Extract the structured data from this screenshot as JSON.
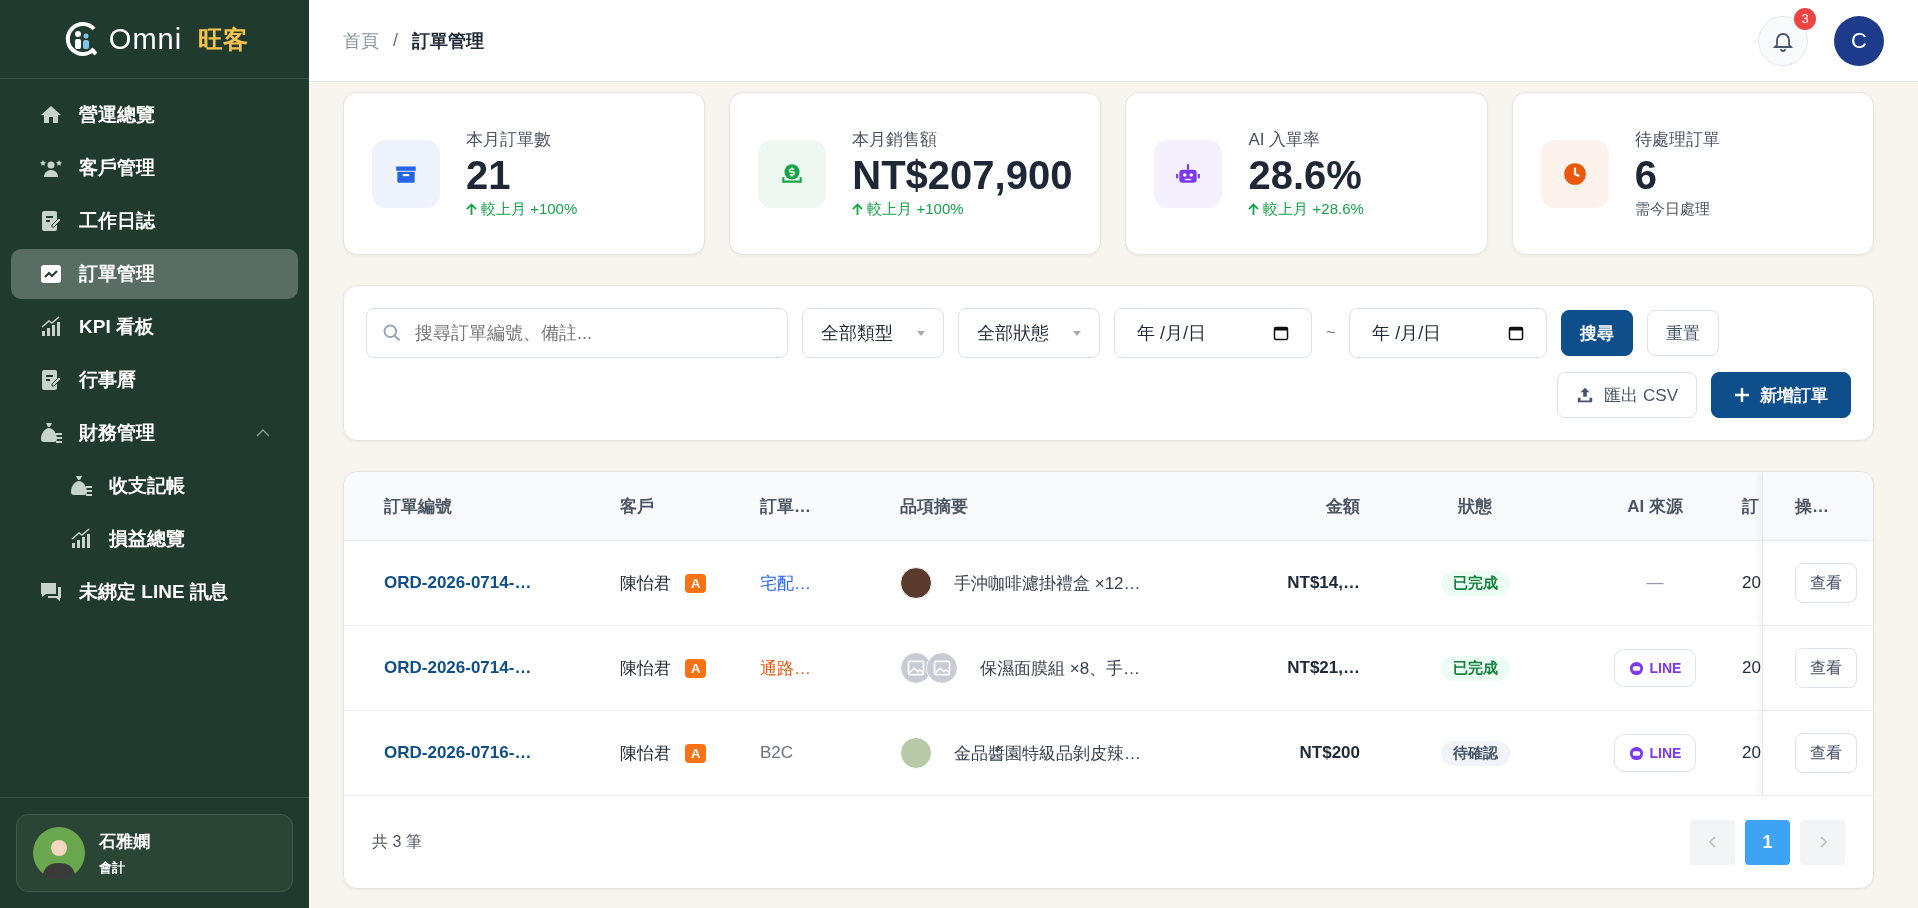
{
  "brand": {
    "name": "Omni",
    "suffix": "旺客"
  },
  "sidebar": {
    "items": [
      {
        "label": "營運總覽",
        "kind": "home",
        "selected": false
      },
      {
        "label": "客戶管理",
        "kind": "people",
        "selected": false
      },
      {
        "label": "工作日誌",
        "kind": "note",
        "selected": false
      },
      {
        "label": "訂單管理",
        "kind": "trend",
        "selected": true
      },
      {
        "label": "KPI 看板",
        "kind": "bars",
        "selected": false
      },
      {
        "label": "行事曆",
        "kind": "note",
        "selected": false
      },
      {
        "label": "財務管理",
        "kind": "money",
        "selected": false,
        "expanded": true,
        "children": [
          {
            "label": "收支記帳",
            "kind": "money",
            "selected": false
          },
          {
            "label": "損益總覽",
            "kind": "bars",
            "selected": false
          }
        ]
      },
      {
        "label": "未綁定 LINE 訊息",
        "kind": "chat",
        "selected": false
      }
    ]
  },
  "user": {
    "name": "石雅嫻",
    "role": "會計"
  },
  "breadcrumb": {
    "separator": "/",
    "items": [
      {
        "label": "首頁"
      },
      {
        "label": "訂單管理"
      }
    ]
  },
  "topbar": {
    "notifications": "3",
    "avatar": "C"
  },
  "stats": [
    {
      "label": "本月訂單數",
      "value": "21",
      "note": "較上月 +100%",
      "kind": "up",
      "color": "#2563eb"
    },
    {
      "label": "本月銷售額",
      "value": "NT$207,900",
      "note": "較上月 +100%",
      "kind": "up",
      "color": "#16a34a"
    },
    {
      "label": "AI 入單率",
      "value": "28.6%",
      "note": "較上月 +28.6%",
      "kind": "up",
      "color": "#7c3aed"
    },
    {
      "label": "待處理訂單",
      "value": "6",
      "note": "需今日處理",
      "kind": "plain",
      "color": "#ea580c"
    }
  ],
  "filters": {
    "search": {
      "placeholder": "搜尋訂單編號、備註..."
    },
    "type_select": "全部類型",
    "status_select": "全部狀態",
    "date_from": "年 /月/日",
    "separator": "~",
    "date_to": "年 /月/日",
    "search_button": "搜尋",
    "reset_button": "重置",
    "export_button": "匯出 CSV",
    "new_button": "新增訂單"
  },
  "table": {
    "columns": [
      "訂單編號",
      "客戶",
      "訂單…",
      "品項摘要",
      "金額",
      "狀態",
      "AI 來源",
      "訂",
      "操…"
    ],
    "rows": [
      {
        "order_no": "ORD-2026-0714-…",
        "customer": "陳怡君",
        "tier": "A",
        "type": {
          "label": "宅配…",
          "color": "#2563eb"
        },
        "thumbs": [
          {
            "kind": "photo"
          }
        ],
        "summary": "手沖咖啡濾掛禮盒 ×12…",
        "amount": "NT$14,…",
        "status": {
          "label": "已完成",
          "kind": "done"
        },
        "ai_source": {
          "label": "—",
          "kind": "none"
        },
        "column_8": "20",
        "action": "查看"
      },
      {
        "order_no": "ORD-2026-0714-…",
        "customer": "陳怡君",
        "tier": "A",
        "type": {
          "label": "通路…",
          "color": "#ea580c"
        },
        "thumbs": [
          {
            "kind": "empty"
          },
          {
            "kind": "empty"
          }
        ],
        "summary": "保濕面膜組 ×8、手…",
        "amount": "NT$21,…",
        "status": {
          "label": "已完成",
          "kind": "done"
        },
        "ai_source": {
          "label": "LINE",
          "kind": "line"
        },
        "column_8": "20",
        "action": "查看"
      },
      {
        "order_no": "ORD-2026-0716-…",
        "customer": "陳怡君",
        "tier": "A",
        "type": {
          "label": "B2C",
          "color": "#6b7280"
        },
        "thumbs": [
          {
            "kind": "plant"
          }
        ],
        "summary": "金品醬園特級品剝皮辣…",
        "amount": "NT$200",
        "status": {
          "label": "待確認",
          "kind": "pending"
        },
        "ai_source": {
          "label": "LINE",
          "kind": "line"
        },
        "column_8": "20",
        "action": "查看"
      }
    ]
  },
  "footer": {
    "total": "共 3 筆",
    "pages": [
      {
        "label": "1",
        "selected": true
      }
    ]
  }
}
